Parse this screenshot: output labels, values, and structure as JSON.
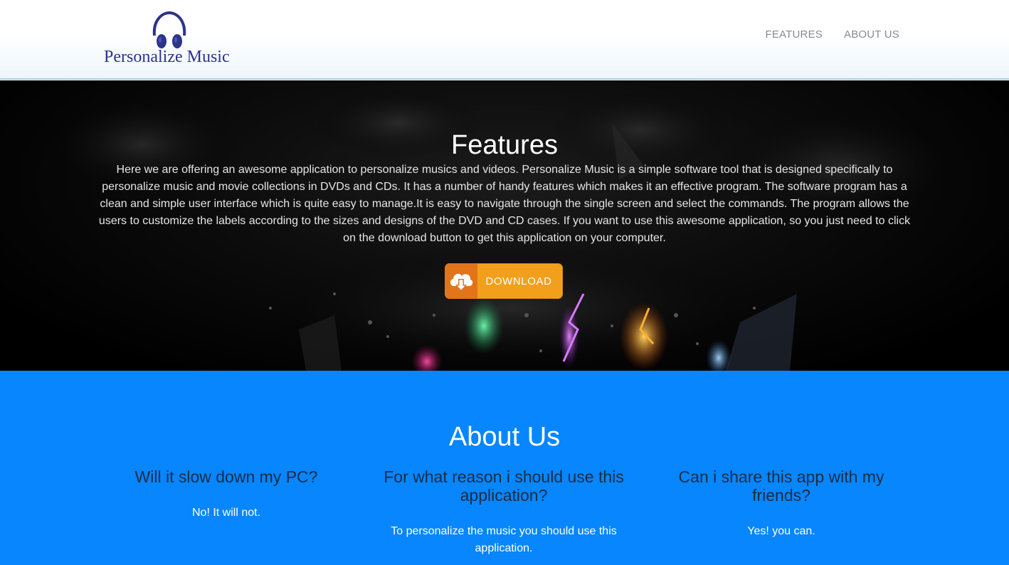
{
  "header": {
    "logo_text": "Personalize Music",
    "logo_icon": "headphones-icon",
    "nav": [
      {
        "label": "FEATURES"
      },
      {
        "label": "ABOUT US"
      }
    ]
  },
  "features": {
    "title": "Features",
    "text": "Here we are offering an awesome application to personalize musics and videos. Personalize Music is a simple software tool that is designed specifically to personalize music and movie collections in DVDs and CDs. It has a number of handy features which makes it an effective program. The software program has a clean and simple user interface which is quite easy to manage.It is easy to navigate through the single screen and select the commands. The program allows the users to customize the labels according to the sizes and designs of the DVD and CD cases. If you want to use this awesome application, so you just need to click on the download button to get this application on your computer.",
    "download_label": "DOWNLOAD",
    "download_icon": "cloud-download-icon"
  },
  "about": {
    "title": "About Us",
    "faqs": [
      {
        "question": "Will it slow down my PC?",
        "answer": "No! It will not."
      },
      {
        "question": "For what reason i should use this application?",
        "answer": "To personalize the music you should use this application."
      },
      {
        "question": "Can i share this app with my friends?",
        "answer": "Yes! you can."
      }
    ]
  },
  "colors": {
    "logo_blue": "#2b3489",
    "nav_gray": "#8a8a8a",
    "download_orange": "#f2a01c",
    "download_dark_orange": "#e2741a",
    "about_blue": "#0786fe",
    "faq_question": "#1c2c44"
  }
}
